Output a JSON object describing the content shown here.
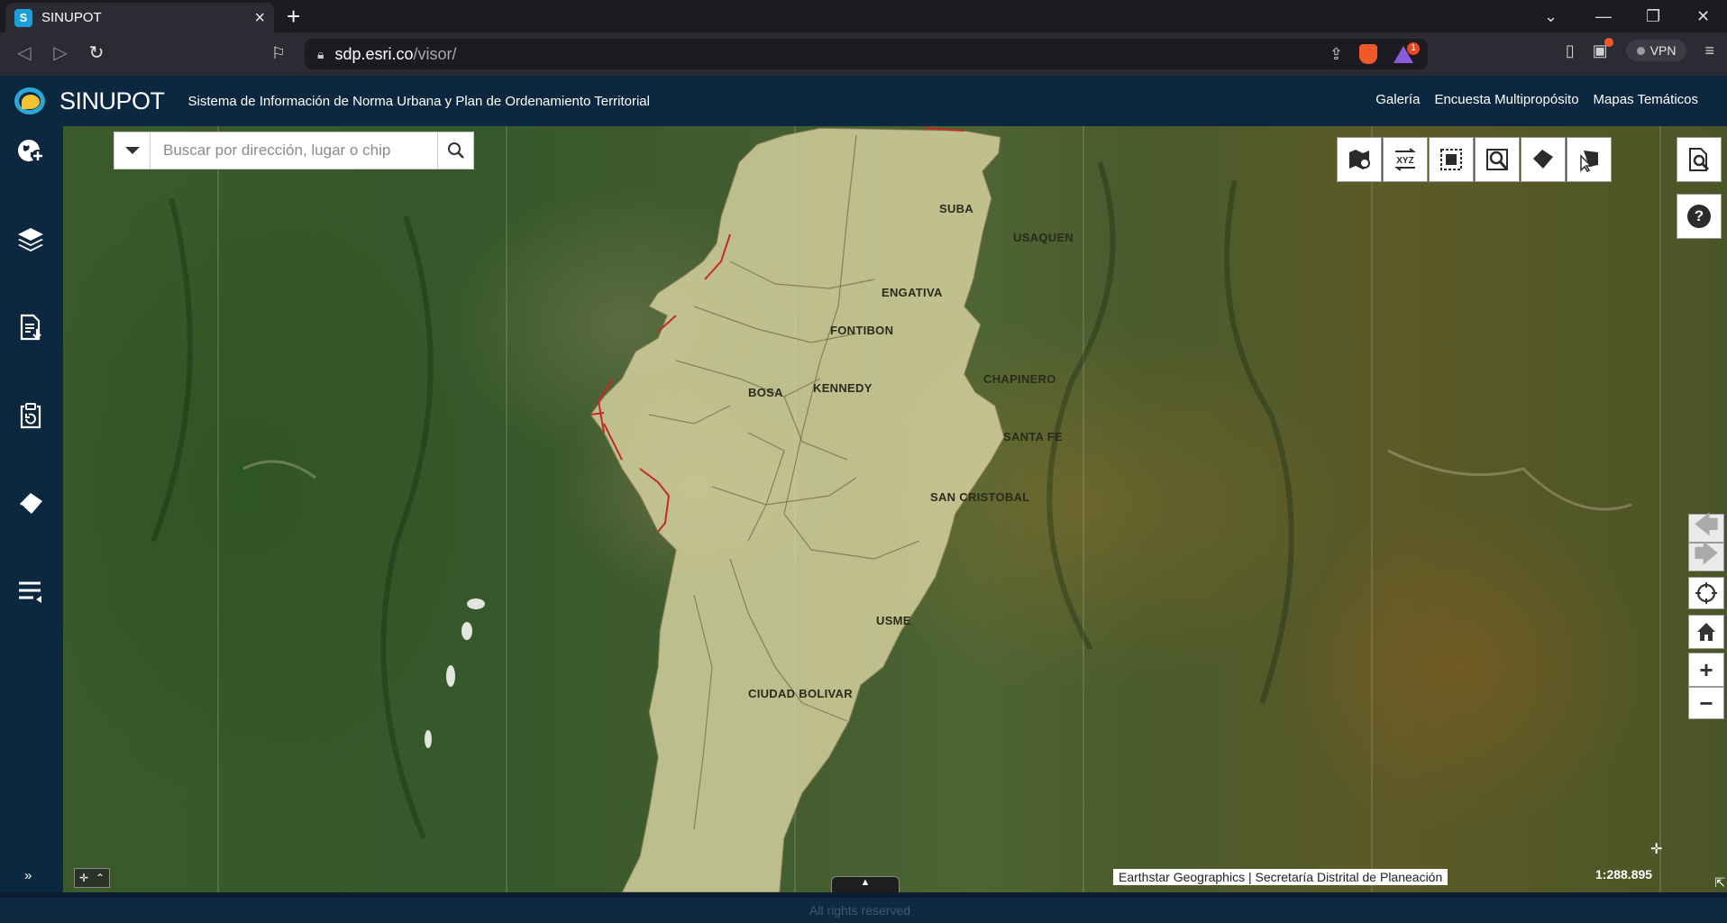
{
  "browser": {
    "tab_title": "SINUPOT",
    "favicon_letter": "S",
    "url_host": "sdp.esri.co",
    "url_path": "/visor/",
    "brave_badge": "1",
    "vpn_label": "VPN"
  },
  "header": {
    "app_name": "SINUPOT",
    "subtitle": "Sistema de Información de Norma Urbana y Plan de Ordenamiento Territorial",
    "links": [
      "Galería",
      "Encuesta Multipropósito",
      "Mapas Temáticos"
    ]
  },
  "sidebar": {
    "items": [
      {
        "icon": "globe-add-icon"
      },
      {
        "icon": "layers-icon"
      },
      {
        "icon": "document-download-icon"
      },
      {
        "icon": "clipboard-refresh-icon"
      },
      {
        "icon": "eraser-icon"
      },
      {
        "icon": "menu-list-icon"
      }
    ],
    "expand_icon": "double-chevron-right-icon"
  },
  "search": {
    "placeholder": "Buscar por dirección, lugar o chip"
  },
  "map_tools": [
    {
      "icon": "map-marker-tool-icon"
    },
    {
      "icon": "xyz-coordinates-icon",
      "label": "XYZ"
    },
    {
      "icon": "select-area-icon"
    },
    {
      "icon": "search-map-icon"
    },
    {
      "icon": "eraser-tool-icon"
    },
    {
      "icon": "identify-pointer-icon"
    },
    {
      "icon": "zoom-document-icon"
    }
  ],
  "help_label": "?",
  "districts": [
    {
      "name": "SUBA"
    },
    {
      "name": "USAQUEN"
    },
    {
      "name": "ENGATIVA"
    },
    {
      "name": "FONTIBON"
    },
    {
      "name": "BOSA"
    },
    {
      "name": "KENNEDY"
    },
    {
      "name": "CHAPINERO"
    },
    {
      "name": "SANTA FE"
    },
    {
      "name": "SAN CRISTOBAL"
    },
    {
      "name": "USME"
    },
    {
      "name": "CIUDAD BOLIVAR"
    }
  ],
  "zoom": {
    "in_label": "+",
    "out_label": "−"
  },
  "scale_text": "1:288.895",
  "attribution": "Earthstar Geographics | Secretaría Distrital de Planeación",
  "footer_text": "All rights reserved",
  "colors": {
    "header_bg": "#0c2840",
    "accent": "#2aa9d9"
  }
}
